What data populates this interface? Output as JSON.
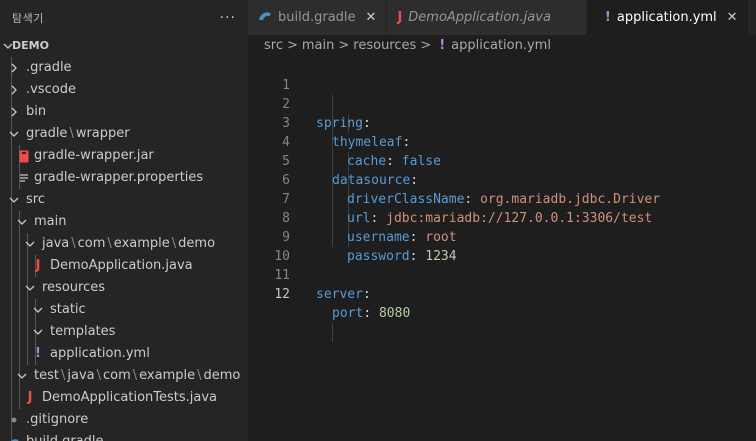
{
  "sidebar": {
    "title": "탐색기",
    "more": "···",
    "root": "DEMO",
    "items": [
      {
        "label": ".gradle"
      },
      {
        "label": ".vscode"
      },
      {
        "label": "bin"
      },
      {
        "parts": [
          "gradle",
          "wrapper"
        ]
      },
      {
        "label": "gradle-wrapper.jar"
      },
      {
        "label": "gradle-wrapper.properties"
      },
      {
        "label": "src"
      },
      {
        "label": "main"
      },
      {
        "parts": [
          "java",
          "com",
          "example",
          "demo"
        ]
      },
      {
        "label": "DemoApplication.java"
      },
      {
        "label": "resources"
      },
      {
        "label": "static"
      },
      {
        "label": "templates"
      },
      {
        "label": "application.yml"
      },
      {
        "parts": [
          "test",
          "java",
          "com",
          "example",
          "demo"
        ]
      },
      {
        "label": "DemoApplicationTests.java"
      },
      {
        "label": ".gitignore"
      },
      {
        "label": "build.gradle"
      }
    ],
    "path_sep": "\\"
  },
  "tabs": [
    {
      "label": "build.gradle"
    },
    {
      "label": "DemoApplication.java"
    },
    {
      "label": "application.yml"
    }
  ],
  "tab_close": "✕",
  "tab_icons": {
    "java": "J",
    "yml": "!"
  },
  "breadcrumbs": {
    "parts": [
      "src",
      "main",
      "resources"
    ],
    "file": "application.yml",
    "sep": ">"
  },
  "code": {
    "line_numbers": [
      "1",
      "2",
      "3",
      "4",
      "5",
      "6",
      "7",
      "8",
      "9",
      "10",
      "11",
      "12"
    ],
    "l2": {
      "k": "spring",
      "c": ":"
    },
    "l3": {
      "k": "thymeleaf",
      "c": ":"
    },
    "l4": {
      "k": "cache",
      "c": ":",
      "v": "false"
    },
    "l5": {
      "k": "datasource",
      "c": ":"
    },
    "l6": {
      "k": "driverClassName",
      "c": ":",
      "v": "org.mariadb.jdbc.Driver"
    },
    "l7": {
      "k": "url",
      "c": ":",
      "v": "jdbc:mariadb://127.0.0.1:3306/test"
    },
    "l8": {
      "k": "username",
      "c": ":",
      "v": "root"
    },
    "l9": {
      "k": "password",
      "c": ":",
      "v": "1234"
    },
    "l11": {
      "k": "server",
      "c": ":"
    },
    "l12": {
      "k": "port",
      "c": ":",
      "v": "8080"
    }
  },
  "colors": {
    "java": "#f14c4c",
    "yml": "#b180d7",
    "gradle": "#4a90c2",
    "jar": "#f14c4c"
  }
}
